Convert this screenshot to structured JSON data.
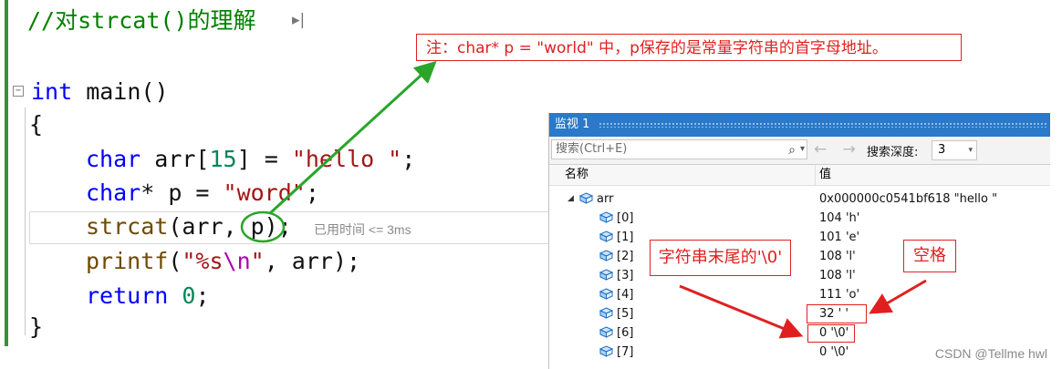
{
  "editor": {
    "comment": "//对strcat()的理解",
    "fold_symbol": "−",
    "lines": {
      "main_kw": "int",
      "main_name": " main()",
      "brace_open": "{",
      "l1_type": "char",
      "l1_rest_a": " arr[",
      "l1_num": "15",
      "l1_rest_b": "] = ",
      "l1_str": "\"hello \"",
      "l1_end": ";",
      "l2_type": "char",
      "l2_rest": "* p = ",
      "l2_str": "\"word\"",
      "l2_end": ";",
      "l3_func": "strcat",
      "l3_rest": "(arr, p);",
      "l4_func": "printf",
      "l4_open": "(",
      "l4_str_a": "\"%s",
      "l4_esc": "\\n",
      "l4_str_b": "\"",
      "l4_rest": ", arr);",
      "l5_kw": "return",
      "l5_sp": " ",
      "l5_num": "0",
      "l5_end": ";",
      "brace_close": "}"
    },
    "elapsed_hint": "已用时间 <= 3ms"
  },
  "note": "注：char* p = \"world\" 中，p保存的是常量字符串的首字母地址。",
  "watch": {
    "title": "监视 1",
    "search_placeholder": "搜索(Ctrl+E)",
    "search_icon_glyph": "⌕",
    "caret": "▾",
    "nav_arrows": "← →",
    "depth_label": "搜索深度:",
    "depth_value": "3",
    "col_name": "名称",
    "col_value": "值",
    "rows": [
      {
        "name": "arr",
        "value": "0x000000c0541bf618 \"hello \"",
        "expanded": "◢"
      },
      {
        "name": "[0]",
        "value": "104 'h'"
      },
      {
        "name": "[1]",
        "value": "101 'e'"
      },
      {
        "name": "[2]",
        "value": "108 'l'"
      },
      {
        "name": "[3]",
        "value": "108 'l'"
      },
      {
        "name": "[4]",
        "value": "111 'o'"
      },
      {
        "name": "[5]",
        "value": "32 ' '"
      },
      {
        "name": "[6]",
        "value": "0 '\\0'"
      },
      {
        "name": "[7]",
        "value": "0 '\\0'"
      }
    ]
  },
  "annotations": {
    "terminator": "字符串末尾的'\\0'",
    "space": "空格"
  },
  "colors": {
    "accent_red": "#e02020",
    "arrow_green": "#2aa52a",
    "watch_title_bg": "#2b79c8"
  },
  "watermark": "CSDN @Tellme hwl"
}
